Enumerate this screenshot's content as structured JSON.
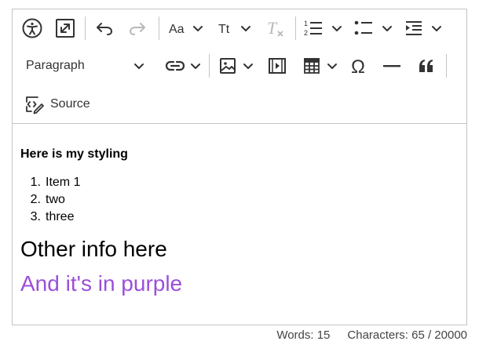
{
  "toolbar": {
    "paragraph_select": {
      "value": "Paragraph"
    },
    "source_label": "Source"
  },
  "content": {
    "heading": "Here is my styling",
    "list_items": [
      {
        "num": "1.",
        "text": "Item 1"
      },
      {
        "num": "2.",
        "text": "two"
      },
      {
        "num": "3.",
        "text": "three"
      }
    ],
    "large_text_1": "Other info here",
    "large_text_2": "And it's in purple",
    "purple_color": "#9b4fd9"
  },
  "status": {
    "words": "Words: 15",
    "characters": "Characters: 65 / 20000"
  },
  "icons": [
    "accessibility-icon",
    "fullscreen-icon",
    "undo-icon",
    "redo-icon",
    "font-family-icon",
    "font-size-icon",
    "remove-format-icon",
    "numbered-list-icon",
    "bulleted-list-icon",
    "indent-icon",
    "link-icon",
    "image-icon",
    "media-icon",
    "table-icon",
    "special-characters-icon",
    "horizontal-line-icon",
    "blockquote-icon",
    "source-code-icon"
  ]
}
